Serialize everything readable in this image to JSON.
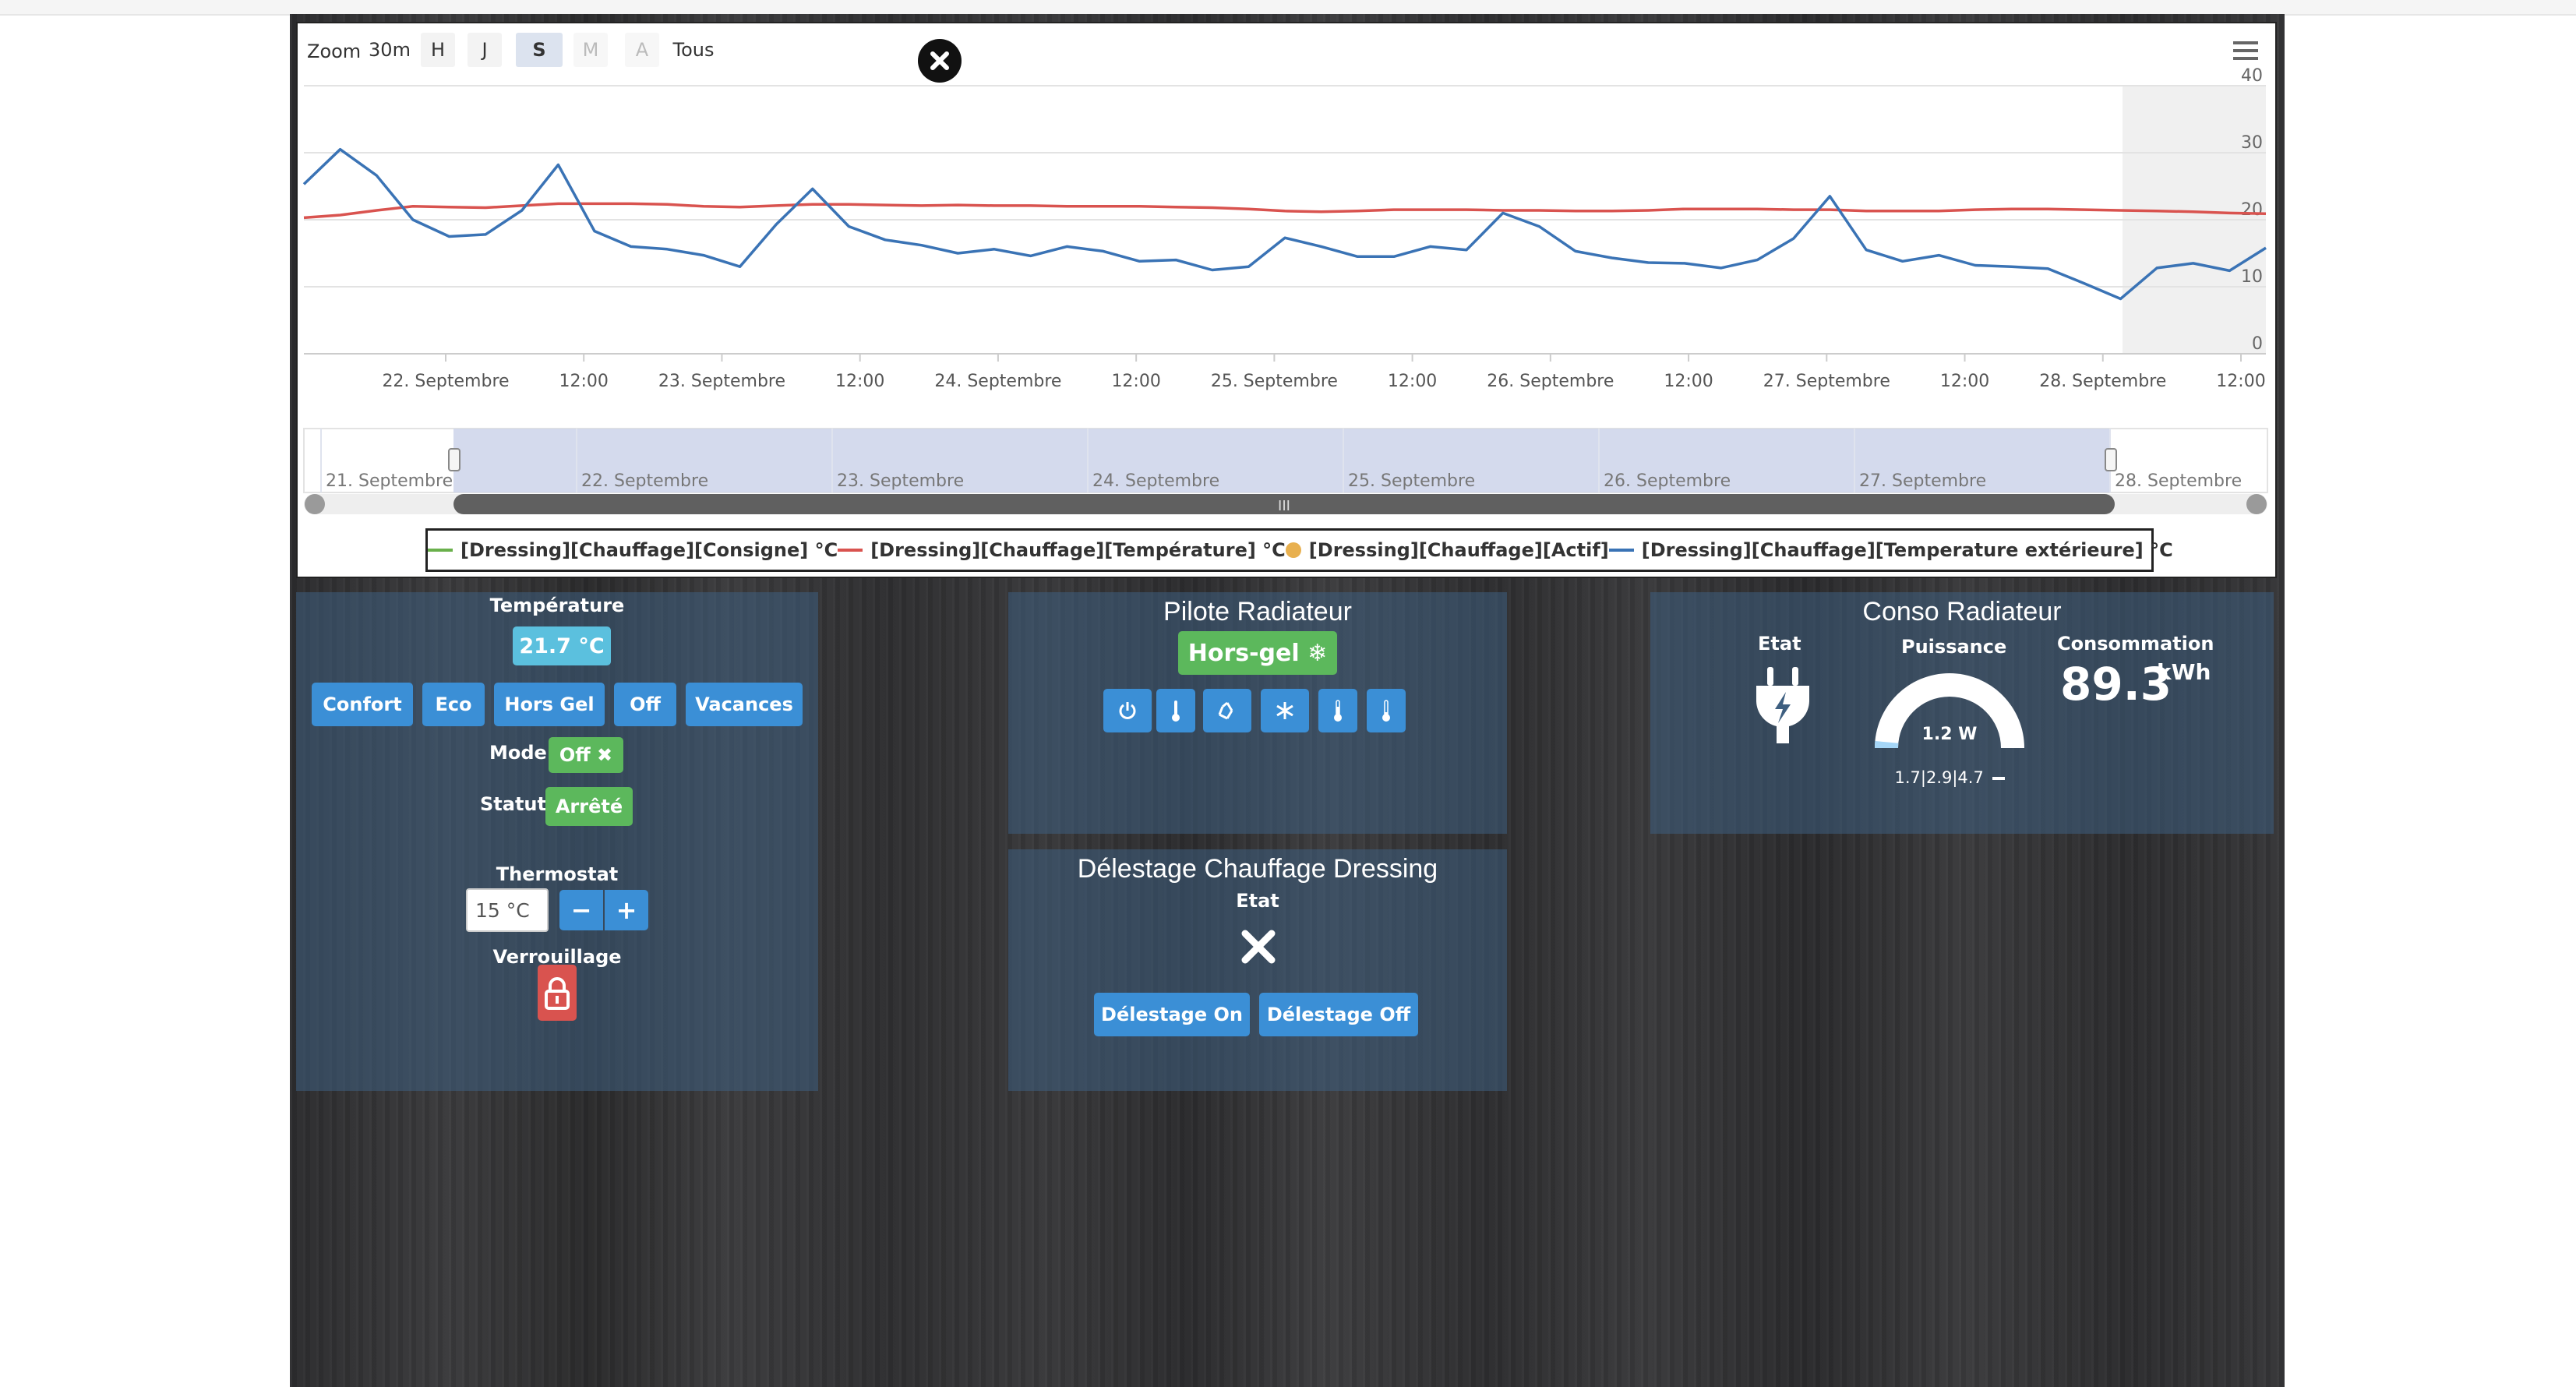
{
  "chart_toolbar": {
    "zoom_label": "Zoom",
    "buttons": [
      "30m",
      "H",
      "J",
      "S",
      "M",
      "A",
      "Tous"
    ],
    "selected": "S",
    "disabled": [
      "M",
      "A"
    ]
  },
  "chart_data": {
    "type": "line",
    "title": "",
    "xlabel": "",
    "ylabel": "",
    "ylim": [
      0,
      40
    ],
    "yticks": [
      "0",
      "10",
      "20",
      "30",
      "40"
    ],
    "x_tick_labels": [
      "22. Septembre",
      "12:00",
      "23. Septembre",
      "12:00",
      "24. Septembre",
      "12:00",
      "25. Septembre",
      "12:00",
      "26. Septembre",
      "12:00",
      "27. Septembre",
      "12:00",
      "28. Septembre",
      "12:00"
    ],
    "x": [
      "21/09 18:00",
      "21/09 21:00",
      "22/09 00:00",
      "22/09 03:00",
      "22/09 06:00",
      "22/09 09:00",
      "22/09 12:00",
      "22/09 15:00",
      "22/09 18:00",
      "22/09 21:00",
      "23/09 00:00",
      "23/09 03:00",
      "23/09 06:00",
      "23/09 09:00",
      "23/09 12:00",
      "23/09 15:00",
      "23/09 18:00",
      "23/09 21:00",
      "24/09 00:00",
      "24/09 03:00",
      "24/09 06:00",
      "24/09 09:00",
      "24/09 12:00",
      "24/09 15:00",
      "24/09 18:00",
      "24/09 21:00",
      "25/09 00:00",
      "25/09 03:00",
      "25/09 06:00",
      "25/09 09:00",
      "25/09 12:00",
      "25/09 15:00",
      "25/09 18:00",
      "25/09 21:00",
      "26/09 00:00",
      "26/09 03:00",
      "26/09 06:00",
      "26/09 09:00",
      "26/09 12:00",
      "26/09 15:00",
      "26/09 18:00",
      "26/09 21:00",
      "27/09 00:00",
      "27/09 03:00",
      "27/09 06:00",
      "27/09 09:00",
      "27/09 12:00",
      "27/09 15:00",
      "27/09 18:00",
      "27/09 21:00",
      "28/09 00:00",
      "28/09 03:00",
      "28/09 06:00",
      "28/09 09:00",
      "28/09 12:00"
    ],
    "series": [
      {
        "name": "[Dressing][Chauffage][Température] °C",
        "color": "#d9534f",
        "values": [
          20.3,
          20.7,
          21.4,
          22.0,
          21.9,
          21.8,
          22.1,
          22.4,
          22.4,
          22.4,
          22.3,
          22.0,
          21.9,
          22.1,
          22.3,
          22.3,
          22.2,
          22.1,
          22.2,
          22.1,
          22.1,
          22.0,
          22.0,
          22.0,
          21.9,
          21.8,
          21.6,
          21.3,
          21.2,
          21.3,
          21.5,
          21.5,
          21.5,
          21.4,
          21.4,
          21.3,
          21.3,
          21.4,
          21.6,
          21.6,
          21.6,
          21.5,
          21.5,
          21.3,
          21.3,
          21.3,
          21.5,
          21.6,
          21.6,
          21.5,
          21.4,
          21.3,
          21.2,
          21.0,
          20.9
        ]
      },
      {
        "name": "[Dressing][Chauffage][Temperature extérieure] °C",
        "color": "#3a73b5",
        "values": [
          25.3,
          30.5,
          26.6,
          20.0,
          17.5,
          17.8,
          21.4,
          28.2,
          18.3,
          16.0,
          15.6,
          14.7,
          13.0,
          19.3,
          24.6,
          19.0,
          17.0,
          16.2,
          15.0,
          15.6,
          14.6,
          16.0,
          15.3,
          13.8,
          14.0,
          12.5,
          13.0,
          17.3,
          16.0,
          14.5,
          14.5,
          16.0,
          15.5,
          21.0,
          19.0,
          15.3,
          14.3,
          13.6,
          13.5,
          12.8,
          14.0,
          17.2,
          23.5,
          15.5,
          13.8,
          14.7,
          13.2,
          13.0,
          12.7,
          10.5,
          8.2,
          12.8,
          13.5,
          12.4,
          15.8
        ]
      }
    ],
    "legend": [
      {
        "name": "[Dressing][Chauffage][Consigne] °C",
        "color": "#6ab04c",
        "shape": "line"
      },
      {
        "name": "[Dressing][Chauffage][Température] °C",
        "color": "#d9534f",
        "shape": "line"
      },
      {
        "name": "[Dressing][Chauffage][Actif]",
        "color": "#e8b04f",
        "shape": "dot"
      },
      {
        "name": "[Dressing][Chauffage][Temperature extérieure] °C",
        "color": "#3a73b5",
        "shape": "line"
      }
    ],
    "legend_position": "bottom",
    "grid": true
  },
  "navigator": {
    "labels": [
      "21. Septembre",
      "22. Septembre",
      "23. Septembre",
      "24. Septembre",
      "25. Septembre",
      "26. Septembre",
      "27. Septembre",
      "28. Septembre"
    ],
    "scroll_grip": "III"
  },
  "thermostat_panel": {
    "temperature_label": "Température",
    "temperature_value": "21.7 °C",
    "mode_buttons": [
      "Confort",
      "Eco",
      "Hors Gel",
      "Off",
      "Vacances"
    ],
    "mode_label": "Mode",
    "mode_value": "Off ✖",
    "statut_label": "Statut",
    "statut_value": "Arrêté",
    "thermostat_label": "Thermostat",
    "thermostat_value": "15 °C",
    "minus": "−",
    "plus": "+",
    "lock_label": "Verrouillage"
  },
  "pilote_panel": {
    "title": "Pilote Radiateur",
    "status": "Hors-gel ❄",
    "icons": [
      "power-icon",
      "thermometer-icon",
      "recycle-icon",
      "snowflake-icon",
      "thermometer-half-icon",
      "thermometer-low-icon"
    ]
  },
  "delestage_panel": {
    "title": "Délestage Chauffage Dressing",
    "etat_label": "Etat",
    "btn_on": "Délestage On",
    "btn_off": "Délestage Off"
  },
  "conso_panel": {
    "title": "Conso Radiateur",
    "etat_label": "Etat",
    "puissance_label": "Puissance",
    "gauge_value": "1.2 W",
    "gauge_level": 0.03,
    "gauge_stats": "1.7|2.9|4.7",
    "consommation_label": "Consommation",
    "consommation_value": "89.3",
    "consommation_unit": "kWh"
  },
  "colors": {
    "panel_bg": "#3e5f80",
    "button_blue": "#3b8fd6",
    "status_green": "#5cb85c",
    "lock_red": "#d9534f",
    "temp_badge": "#5bc0de"
  }
}
